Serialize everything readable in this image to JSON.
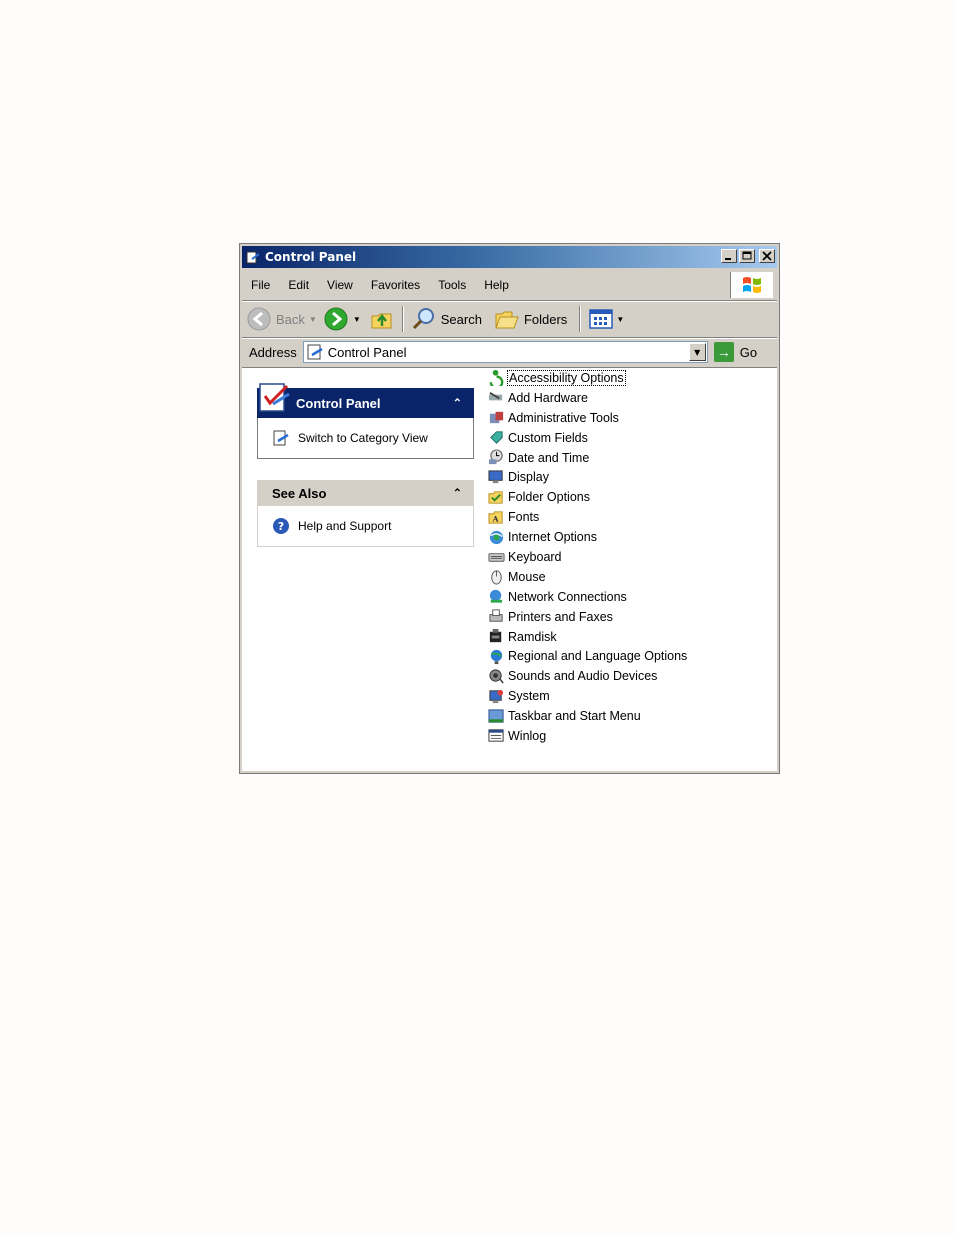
{
  "window": {
    "title": "Control Panel",
    "controls": [
      "minimize",
      "maximize",
      "close"
    ]
  },
  "menubar": {
    "items": [
      "File",
      "Edit",
      "View",
      "Favorites",
      "Tools",
      "Help"
    ]
  },
  "toolbar": {
    "back_label": "Back",
    "search_label": "Search",
    "folders_label": "Folders"
  },
  "address": {
    "label": "Address",
    "value": "Control Panel",
    "go_label": "Go"
  },
  "tasks": {
    "control_panel": {
      "title": "Control Panel",
      "link": "Switch to Category View"
    },
    "see_also": {
      "title": "See Also",
      "link": "Help and Support"
    }
  },
  "items": [
    {
      "label": "Accessibility Options",
      "icon": "accessibility-icon",
      "selected": true
    },
    {
      "label": "Add Hardware",
      "icon": "add-hardware-icon"
    },
    {
      "label": "Administrative Tools",
      "icon": "administrative-tools-icon"
    },
    {
      "label": "Custom Fields",
      "icon": "custom-fields-icon"
    },
    {
      "label": "Date and Time",
      "icon": "date-time-icon"
    },
    {
      "label": "Display",
      "icon": "display-icon"
    },
    {
      "label": "Folder Options",
      "icon": "folder-options-icon"
    },
    {
      "label": "Fonts",
      "icon": "fonts-icon"
    },
    {
      "label": "Internet Options",
      "icon": "internet-options-icon"
    },
    {
      "label": "Keyboard",
      "icon": "keyboard-icon"
    },
    {
      "label": "Mouse",
      "icon": "mouse-icon"
    },
    {
      "label": "Network Connections",
      "icon": "network-connections-icon"
    },
    {
      "label": "Printers and Faxes",
      "icon": "printers-faxes-icon"
    },
    {
      "label": "Ramdisk",
      "icon": "ramdisk-icon"
    },
    {
      "label": "Regional and Language Options",
      "icon": "regional-language-icon"
    },
    {
      "label": "Sounds and Audio Devices",
      "icon": "sounds-audio-icon"
    },
    {
      "label": "System",
      "icon": "system-icon"
    },
    {
      "label": "Taskbar and Start Menu",
      "icon": "taskbar-start-menu-icon"
    },
    {
      "label": "Winlog",
      "icon": "winlog-icon"
    }
  ],
  "colors": {
    "title_bar": "#0a246a",
    "window_face": "#d4d0c8",
    "task_header_blue": "#0a246a"
  }
}
